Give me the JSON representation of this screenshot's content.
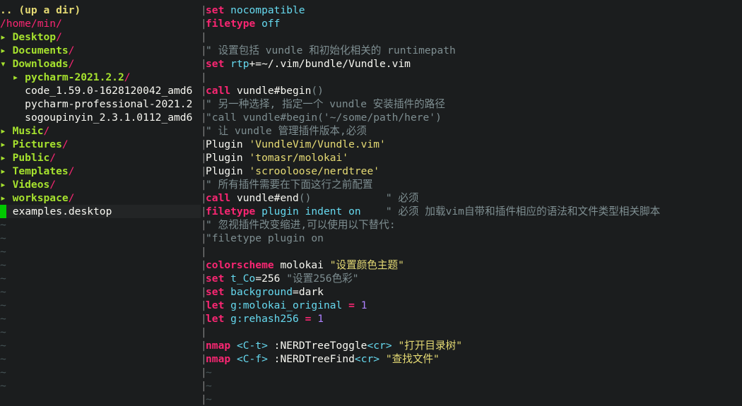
{
  "tree": {
    "items": [
      {
        "kind": "up",
        "text": ".. (up a dir)"
      },
      {
        "kind": "root",
        "text": "/home/min/"
      },
      {
        "kind": "dir",
        "indent": "",
        "arrow": "▸ ",
        "name": "Desktop",
        "slash": "/"
      },
      {
        "kind": "dir",
        "indent": "",
        "arrow": "▸ ",
        "name": "Documents",
        "slash": "/"
      },
      {
        "kind": "dir",
        "indent": "",
        "arrow": "▾ ",
        "name": "Downloads",
        "slash": "/"
      },
      {
        "kind": "dir",
        "indent": "  ",
        "arrow": "▸ ",
        "name": "pycharm-2021.2.2",
        "slash": "/"
      },
      {
        "kind": "file",
        "indent": "    ",
        "name": "code_1.59.0-1628120042_amd6"
      },
      {
        "kind": "file",
        "indent": "    ",
        "name": "pycharm-professional-2021.2"
      },
      {
        "kind": "file",
        "indent": "    ",
        "name": "sogoupinyin_2.3.1.0112_amd6"
      },
      {
        "kind": "dir",
        "indent": "",
        "arrow": "▸ ",
        "name": "Music",
        "slash": "/"
      },
      {
        "kind": "dir",
        "indent": "",
        "arrow": "▸ ",
        "name": "Pictures",
        "slash": "/"
      },
      {
        "kind": "dir",
        "indent": "",
        "arrow": "▸ ",
        "name": "Public",
        "slash": "/"
      },
      {
        "kind": "dir",
        "indent": "",
        "arrow": "▸ ",
        "name": "Templates",
        "slash": "/"
      },
      {
        "kind": "dir",
        "indent": "",
        "arrow": "▸ ",
        "name": "Videos",
        "slash": "/"
      },
      {
        "kind": "dir",
        "indent": "",
        "arrow": "▸ ",
        "name": "workspace",
        "slash": "/"
      },
      {
        "kind": "cursor",
        "indent": "  ",
        "name": "examples.desktop"
      }
    ],
    "tilde": "~",
    "tilde_rows": 13
  },
  "separator": "|",
  "code": {
    "lines": [
      [
        [
          "kw",
          "set"
        ],
        [
          "plain",
          " "
        ],
        [
          "opt",
          "nocompatible"
        ]
      ],
      [
        [
          "kw",
          "filetype"
        ],
        [
          "plain",
          " "
        ],
        [
          "opt",
          "off"
        ]
      ],
      [],
      [
        [
          "cm",
          "\" 设置包括 vundle 和初始化相关的 runtimepath"
        ]
      ],
      [
        [
          "kw",
          "set"
        ],
        [
          "plain",
          " "
        ],
        [
          "opt",
          "rtp"
        ],
        [
          "plain",
          "+=~/.vim/bundle/Vundle.vim"
        ]
      ],
      [],
      [
        [
          "kw",
          "call"
        ],
        [
          "plain",
          " vundle#begin"
        ],
        [
          "cm",
          "()"
        ]
      ],
      [
        [
          "cm",
          "\" 另一种选择, 指定一个 vundle 安装插件的路径"
        ]
      ],
      [
        [
          "cm",
          "\"call vundle#begin('~/some/path/here')"
        ]
      ],
      [
        [
          "cm",
          "\" 让 vundle 管理插件版本,必须"
        ]
      ],
      [
        [
          "plain",
          "Plugin "
        ],
        [
          "str",
          "'VundleVim/Vundle.vim'"
        ]
      ],
      [
        [
          "plain",
          "Plugin "
        ],
        [
          "str",
          "'tomasr/molokai'"
        ]
      ],
      [
        [
          "plain",
          "Plugin "
        ],
        [
          "str",
          "'scrooloose/nerdtree'"
        ]
      ],
      [
        [
          "cm",
          "\" 所有插件需要在下面这行之前配置"
        ]
      ],
      [
        [
          "kw",
          "call"
        ],
        [
          "plain",
          " vundle#end"
        ],
        [
          "cm",
          "()"
        ],
        [
          "plain",
          "            "
        ],
        [
          "cm",
          "\" 必须"
        ]
      ],
      [
        [
          "kw",
          "filetype"
        ],
        [
          "plain",
          " "
        ],
        [
          "opt",
          "plugin"
        ],
        [
          "plain",
          " "
        ],
        [
          "opt",
          "indent"
        ],
        [
          "plain",
          " "
        ],
        [
          "opt",
          "on"
        ],
        [
          "plain",
          "    "
        ],
        [
          "cm",
          "\" 必须 加载vim自带和插件相应的语法和文件类型相关脚本"
        ]
      ],
      [
        [
          "cm",
          "\" 忽视插件改变缩进,可以使用以下替代:"
        ]
      ],
      [
        [
          "cm",
          "\"filetype plugin on"
        ]
      ],
      [],
      [
        [
          "kw",
          "colorscheme"
        ],
        [
          "plain",
          " molokai "
        ],
        [
          "str",
          "\"设置颜色主题\""
        ]
      ],
      [
        [
          "kw",
          "set"
        ],
        [
          "plain",
          " "
        ],
        [
          "opt",
          "t_Co"
        ],
        [
          "plain",
          "=256 "
        ],
        [
          "cm",
          "\"设置256色彩\""
        ]
      ],
      [
        [
          "kw",
          "set"
        ],
        [
          "plain",
          " "
        ],
        [
          "opt",
          "background"
        ],
        [
          "plain",
          "=dark"
        ]
      ],
      [
        [
          "kw",
          "let"
        ],
        [
          "plain",
          " "
        ],
        [
          "opt",
          "g:molokai_original"
        ],
        [
          "plain",
          " "
        ],
        [
          "kw",
          "="
        ],
        [
          "plain",
          " "
        ],
        [
          "num",
          "1"
        ]
      ],
      [
        [
          "kw",
          "let"
        ],
        [
          "plain",
          " "
        ],
        [
          "opt",
          "g:rehash256"
        ],
        [
          "plain",
          " "
        ],
        [
          "kw",
          "="
        ],
        [
          "plain",
          " "
        ],
        [
          "num",
          "1"
        ]
      ],
      [],
      [
        [
          "kw",
          "nmap"
        ],
        [
          "plain",
          " "
        ],
        [
          "key",
          "<C-t>"
        ],
        [
          "plain",
          " :NERDTreeToggle"
        ],
        [
          "key",
          "<cr>"
        ],
        [
          "plain",
          " "
        ],
        [
          "str",
          "\"打开目录树\""
        ]
      ],
      [
        [
          "kw",
          "nmap"
        ],
        [
          "plain",
          " "
        ],
        [
          "key",
          "<C-f>"
        ],
        [
          "plain",
          " :NERDTreeFind"
        ],
        [
          "key",
          "<cr>"
        ],
        [
          "plain",
          " "
        ],
        [
          "str",
          "\"查找文件\""
        ]
      ],
      [
        [
          "tilde",
          "~"
        ]
      ],
      [
        [
          "tilde",
          "~"
        ]
      ],
      [
        [
          "tilde",
          "~"
        ]
      ]
    ]
  },
  "colors": {
    "background": "#1b1d1e",
    "keyword": "#f92672",
    "option": "#66d9ef",
    "comment": "#7e8e91",
    "string": "#e6db74",
    "number": "#ae81ff",
    "directory": "#a6e22e",
    "cursor": "#00c800"
  }
}
